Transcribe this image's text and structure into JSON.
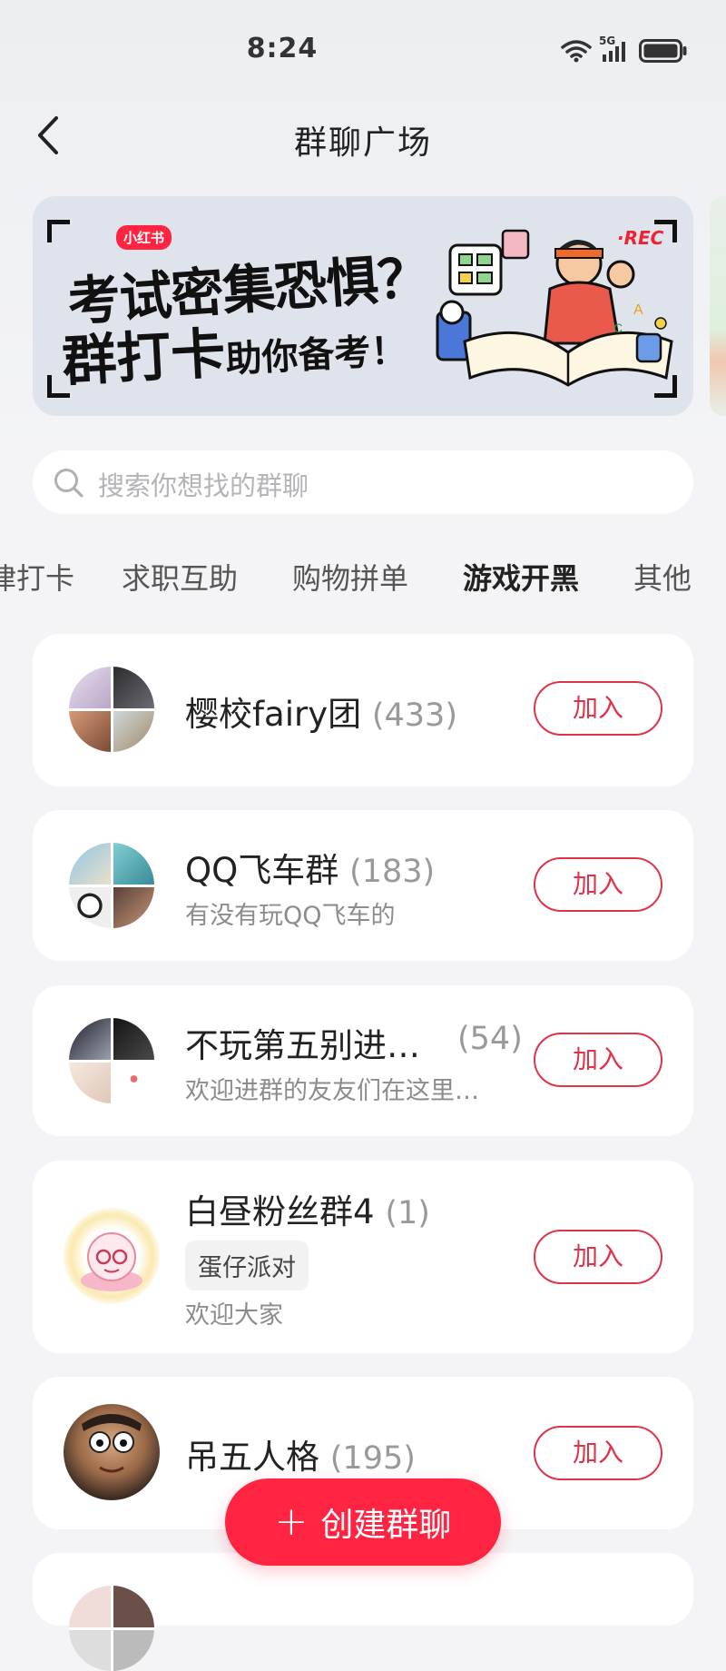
{
  "status_bar": {
    "time": "8:24",
    "network": "5G"
  },
  "header": {
    "title": "群聊广场"
  },
  "banner": {
    "brand": "小红书",
    "rec": "·REC",
    "line1": "考试密集恐惧？",
    "line2_big": "群打卡",
    "line2_small": "助你备考！"
  },
  "search": {
    "placeholder": "搜索你想找的群聊"
  },
  "tabs": [
    {
      "label": "律打卡"
    },
    {
      "label": "求职互助"
    },
    {
      "label": "购物拼单"
    },
    {
      "label": "游戏开黑",
      "active": true
    },
    {
      "label": "其他"
    }
  ],
  "groups": [
    {
      "name": "樱校fairy团",
      "count": "(433)",
      "desc": "",
      "tag": "",
      "join": "加入"
    },
    {
      "name": "QQ飞车群",
      "count": "(183)",
      "desc": "有没有玩QQ飞车的",
      "tag": "",
      "join": "加入"
    },
    {
      "name": "不玩第五别进…",
      "count": "(54)",
      "desc": "欢迎进群的友友们在这里…",
      "tag": "",
      "join": "加入"
    },
    {
      "name": "白昼粉丝群4",
      "count": "(1)",
      "desc": "欢迎大家",
      "tag": "蛋仔派对",
      "join": "加入"
    },
    {
      "name": "吊五人格",
      "count": "(195)",
      "desc": "",
      "tag": "",
      "join": "加入"
    }
  ],
  "fab": {
    "label": "创建群聊"
  },
  "colors": {
    "accent": "#ff2442",
    "join_border": "#e0334a",
    "background": "#f4f4f6"
  }
}
